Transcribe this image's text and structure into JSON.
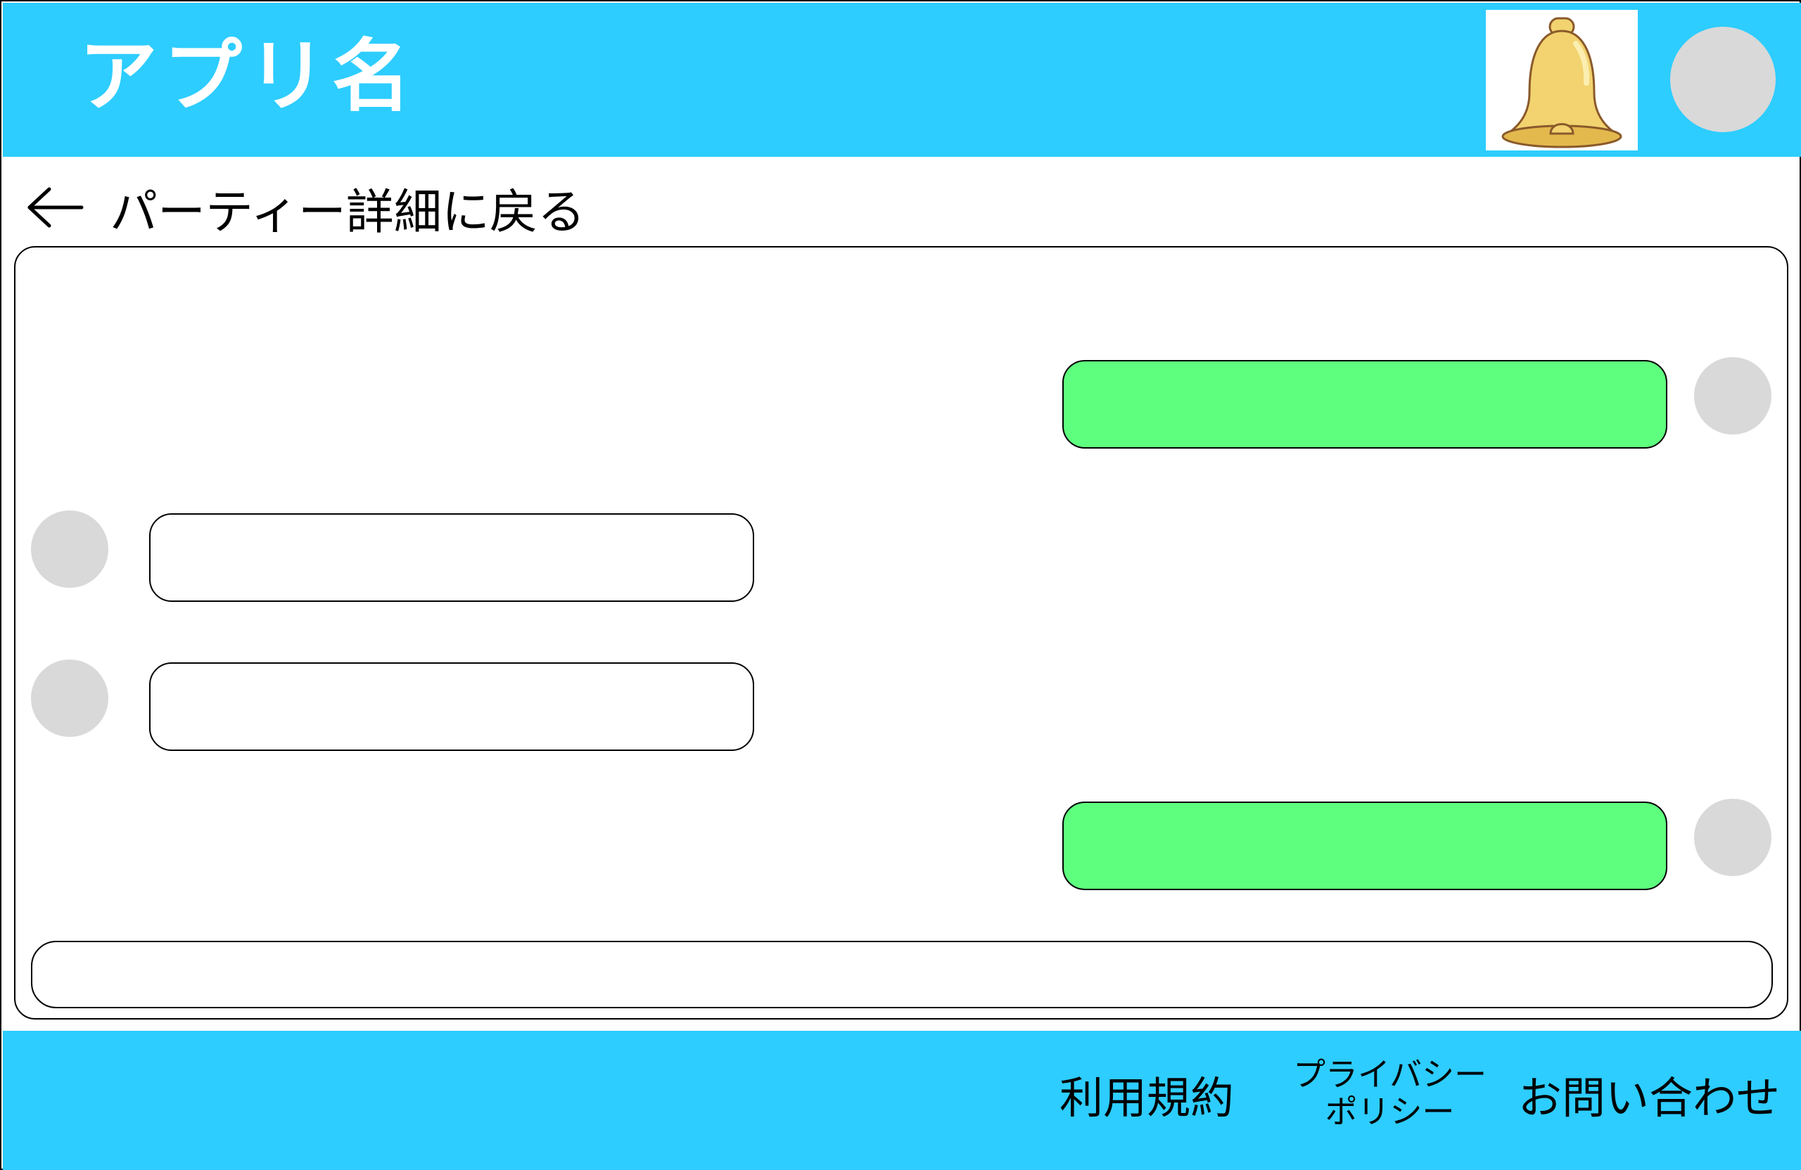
{
  "colors": {
    "accent": "#2dcdff",
    "bubble_mine": "#5eff7e",
    "bubble_theirs": "#ffffff",
    "avatar": "#d9d9d9",
    "bell": "#f2d370"
  },
  "header": {
    "app_title": "アプリ名",
    "notification_icon": "bell-icon",
    "profile_icon": "avatar"
  },
  "back_link": {
    "icon": "left-arrow-icon",
    "label": "パーティー詳細に戻る"
  },
  "chat": {
    "messages": [
      {
        "sender": "self",
        "text": ""
      },
      {
        "sender": "other",
        "text": ""
      },
      {
        "sender": "other",
        "text": ""
      },
      {
        "sender": "self",
        "text": ""
      }
    ],
    "input": {
      "value": "",
      "placeholder": ""
    }
  },
  "footer": {
    "links": [
      {
        "label": "利用規約"
      },
      {
        "label_line1": "プライバシー",
        "label_line2": "ポリシー"
      },
      {
        "label": "お問い合わせ"
      }
    ]
  }
}
